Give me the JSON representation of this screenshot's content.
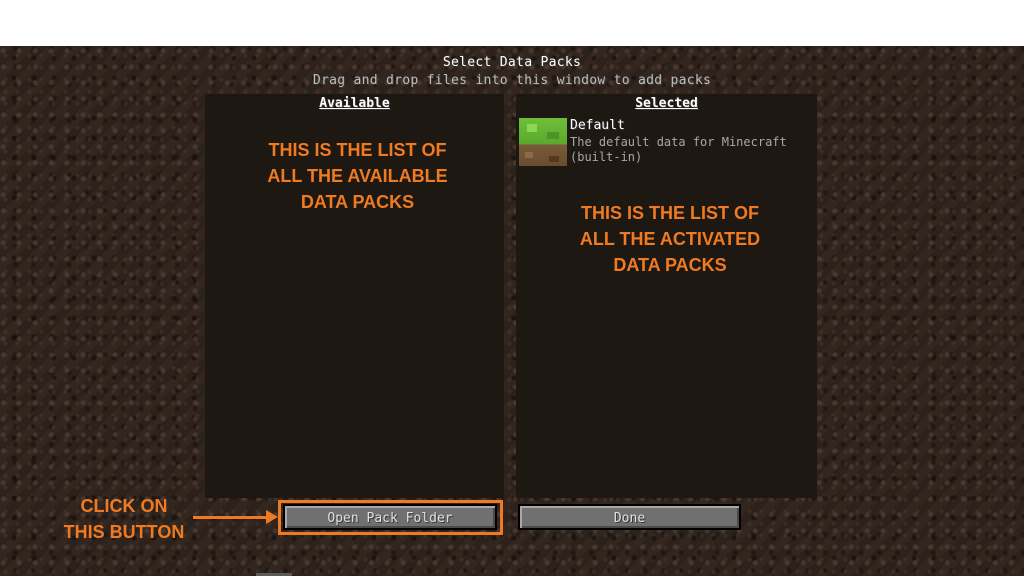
{
  "screen": {
    "title": "Select Data Packs",
    "subtitle": "Drag and drop files into this window to add packs"
  },
  "available_panel": {
    "heading": "Available"
  },
  "selected_panel": {
    "heading": "Selected",
    "packs": [
      {
        "name": "Default",
        "description_line1": "The default data for Minecraft",
        "description_line2": "(built-in)",
        "icon": "grass-block-icon"
      }
    ]
  },
  "buttons": {
    "open_pack_folder": "Open Pack Folder",
    "done": "Done"
  },
  "annotations": {
    "available": [
      "THIS IS THE LIST OF",
      "ALL THE AVAILABLE",
      "DATA PACKS"
    ],
    "selected": [
      "THIS IS THE LIST OF",
      "ALL THE ACTIVATED",
      "DATA PACKS"
    ],
    "click": [
      "CLICK ON",
      "THIS BUTTON"
    ],
    "color": "#f07a22"
  }
}
